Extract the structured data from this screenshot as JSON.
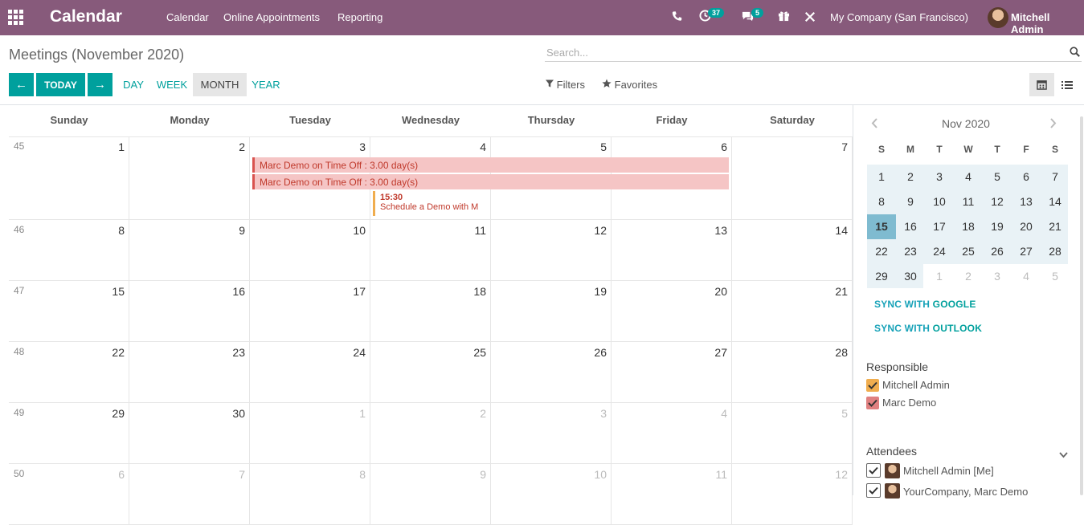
{
  "navbar": {
    "app_name": "Calendar",
    "menu": [
      "Calendar",
      "Online Appointments",
      "Reporting"
    ],
    "activity_badge": "37",
    "messages_badge": "5",
    "company": "My Company (San Francisco)",
    "user": "Mitchell Admin",
    "accent_color": "#875a7b"
  },
  "control": {
    "breadcrumb": "Meetings (November 2020)",
    "search_placeholder": "Search...",
    "prev_label": "←",
    "today_label": "TODAY",
    "next_label": "→",
    "scales": [
      "DAY",
      "WEEK",
      "MONTH",
      "YEAR"
    ],
    "active_scale": "MONTH",
    "filters_label": "Filters",
    "favorites_label": "Favorites"
  },
  "calendar": {
    "weekdays": [
      "Sunday",
      "Monday",
      "Tuesday",
      "Wednesday",
      "Thursday",
      "Friday",
      "Saturday"
    ],
    "weeks": [
      {
        "num": "45",
        "days": [
          {
            "d": "1"
          },
          {
            "d": "2"
          },
          {
            "d": "3"
          },
          {
            "d": "4"
          },
          {
            "d": "5"
          },
          {
            "d": "6"
          },
          {
            "d": "7"
          }
        ]
      },
      {
        "num": "46",
        "days": [
          {
            "d": "8"
          },
          {
            "d": "9"
          },
          {
            "d": "10"
          },
          {
            "d": "11"
          },
          {
            "d": "12"
          },
          {
            "d": "13"
          },
          {
            "d": "14"
          }
        ]
      },
      {
        "num": "47",
        "days": [
          {
            "d": "15"
          },
          {
            "d": "16"
          },
          {
            "d": "17"
          },
          {
            "d": "18"
          },
          {
            "d": "19"
          },
          {
            "d": "20"
          },
          {
            "d": "21"
          }
        ]
      },
      {
        "num": "48",
        "days": [
          {
            "d": "22"
          },
          {
            "d": "23"
          },
          {
            "d": "24"
          },
          {
            "d": "25"
          },
          {
            "d": "26"
          },
          {
            "d": "27"
          },
          {
            "d": "28"
          }
        ]
      },
      {
        "num": "49",
        "days": [
          {
            "d": "29"
          },
          {
            "d": "30"
          },
          {
            "d": "1",
            "muted": true
          },
          {
            "d": "2",
            "muted": true
          },
          {
            "d": "3",
            "muted": true
          },
          {
            "d": "4",
            "muted": true
          },
          {
            "d": "5",
            "muted": true
          }
        ]
      },
      {
        "num": "50",
        "days": [
          {
            "d": "6",
            "muted": true
          },
          {
            "d": "7",
            "muted": true
          },
          {
            "d": "8",
            "muted": true
          },
          {
            "d": "9",
            "muted": true
          },
          {
            "d": "10",
            "muted": true
          },
          {
            "d": "11",
            "muted": true
          },
          {
            "d": "12",
            "muted": true
          }
        ]
      }
    ],
    "events": [
      {
        "label": "Marc Demo on Time Off : 3.00 day(s)"
      },
      {
        "label": "Marc Demo on Time Off : 3.00 day(s)"
      },
      {
        "time": "15:30",
        "label": "Schedule a Demo with M"
      }
    ]
  },
  "sidebar": {
    "month_label": "Nov 2020",
    "dow": [
      "S",
      "M",
      "T",
      "W",
      "T",
      "F",
      "S"
    ],
    "mini_weeks": [
      [
        "1",
        "2",
        "3",
        "4",
        "5",
        "6",
        "7"
      ],
      [
        "8",
        "9",
        "10",
        "11",
        "12",
        "13",
        "14"
      ],
      [
        "15",
        "16",
        "17",
        "18",
        "19",
        "20",
        "21"
      ],
      [
        "22",
        "23",
        "24",
        "25",
        "26",
        "27",
        "28"
      ],
      [
        "29",
        "30",
        "1",
        "2",
        "3",
        "4",
        "5"
      ]
    ],
    "today": "15",
    "sync_google_prefix": "SYNC WITH ",
    "sync_google": "GOOGLE",
    "sync_outlook_prefix": "SYNC WITH ",
    "sync_outlook": "OUTLOOK",
    "responsible_title": "Responsible",
    "responsible": [
      {
        "name": "Mitchell Admin",
        "color": "#f0ad4e"
      },
      {
        "name": "Marc Demo",
        "color": "#e08080"
      }
    ],
    "attendees_title": "Attendees",
    "attendees": [
      "Mitchell Admin [Me]",
      "YourCompany, Marc Demo"
    ]
  }
}
